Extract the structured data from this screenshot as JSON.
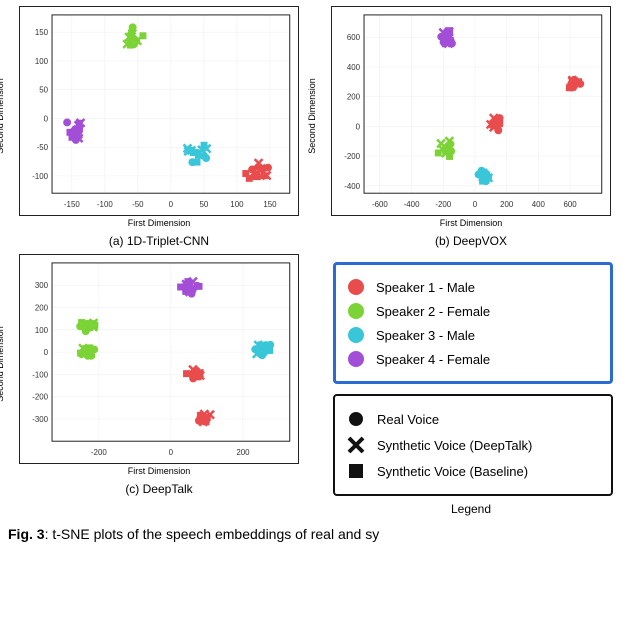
{
  "captions": {
    "a": "(a) 1D-Triplet-CNN",
    "b": "(b) DeepVOX",
    "c": "(c) DeepTalk",
    "legend": "Legend"
  },
  "axes": {
    "ylabel": "Second Dimension",
    "xlabel": "First Dimension"
  },
  "legend_speakers": [
    {
      "label": "Speaker 1 - Male",
      "color": "#e84c4c"
    },
    {
      "label": "Speaker 2 - Female",
      "color": "#7bd336"
    },
    {
      "label": "Speaker 3 - Male",
      "color": "#39c6d8"
    },
    {
      "label": "Speaker 4 - Female",
      "color": "#a24ed6"
    }
  ],
  "legend_marks": [
    {
      "label": "Real Voice",
      "mark": "circle"
    },
    {
      "label": "Synthetic Voice (DeepTalk)",
      "mark": "x"
    },
    {
      "label": "Synthetic Voice (Baseline)",
      "mark": "square"
    }
  ],
  "fig_caption": "Fig. 3: t-SNE plots of the speech embeddings of real and sy",
  "chart_data": [
    {
      "id": "a",
      "type": "scatter",
      "xlim": [
        -180,
        180
      ],
      "ylim": [
        -130,
        180
      ],
      "xticks": [
        -150,
        -100,
        -50,
        0,
        50,
        100,
        150
      ],
      "yticks": [
        -100,
        -50,
        0,
        50,
        100,
        150
      ],
      "clusters": [
        {
          "speaker": 1,
          "cx": 130,
          "cy": -95,
          "spread": 20
        },
        {
          "speaker": 2,
          "cx": -60,
          "cy": 140,
          "spread": 20
        },
        {
          "speaker": 3,
          "cx": 40,
          "cy": -60,
          "spread": 18
        },
        {
          "speaker": 4,
          "cx": -145,
          "cy": -20,
          "spread": 20
        }
      ]
    },
    {
      "id": "b",
      "type": "scatter",
      "xlim": [
        -700,
        800
      ],
      "ylim": [
        -450,
        750
      ],
      "xticks": [
        -600,
        -400,
        -200,
        0,
        200,
        400,
        600
      ],
      "yticks": [
        -400,
        -200,
        0,
        200,
        400,
        600
      ],
      "clusters": [
        {
          "speaker": 1,
          "cx": 150,
          "cy": 20,
          "spread": 60
        },
        {
          "speaker": 1,
          "cx": 620,
          "cy": 300,
          "spread": 50
        },
        {
          "speaker": 2,
          "cx": -180,
          "cy": -150,
          "spread": 60
        },
        {
          "speaker": 3,
          "cx": 60,
          "cy": -340,
          "spread": 50
        },
        {
          "speaker": 4,
          "cx": -170,
          "cy": 610,
          "spread": 60
        }
      ]
    },
    {
      "id": "c",
      "type": "scatter",
      "xlim": [
        -330,
        330
      ],
      "ylim": [
        -400,
        400
      ],
      "xticks": [
        -200,
        0,
        200
      ],
      "yticks": [
        -300,
        -200,
        -100,
        0,
        100,
        200,
        300
      ],
      "clusters": [
        {
          "speaker": 1,
          "cx": 95,
          "cy": -300,
          "spread": 30
        },
        {
          "speaker": 1,
          "cx": 65,
          "cy": -100,
          "spread": 25
        },
        {
          "speaker": 2,
          "cx": -230,
          "cy": 115,
          "spread": 30
        },
        {
          "speaker": 2,
          "cx": -230,
          "cy": 5,
          "spread": 25
        },
        {
          "speaker": 3,
          "cx": 260,
          "cy": 10,
          "spread": 30
        },
        {
          "speaker": 4,
          "cx": 55,
          "cy": 290,
          "spread": 30
        }
      ]
    }
  ]
}
